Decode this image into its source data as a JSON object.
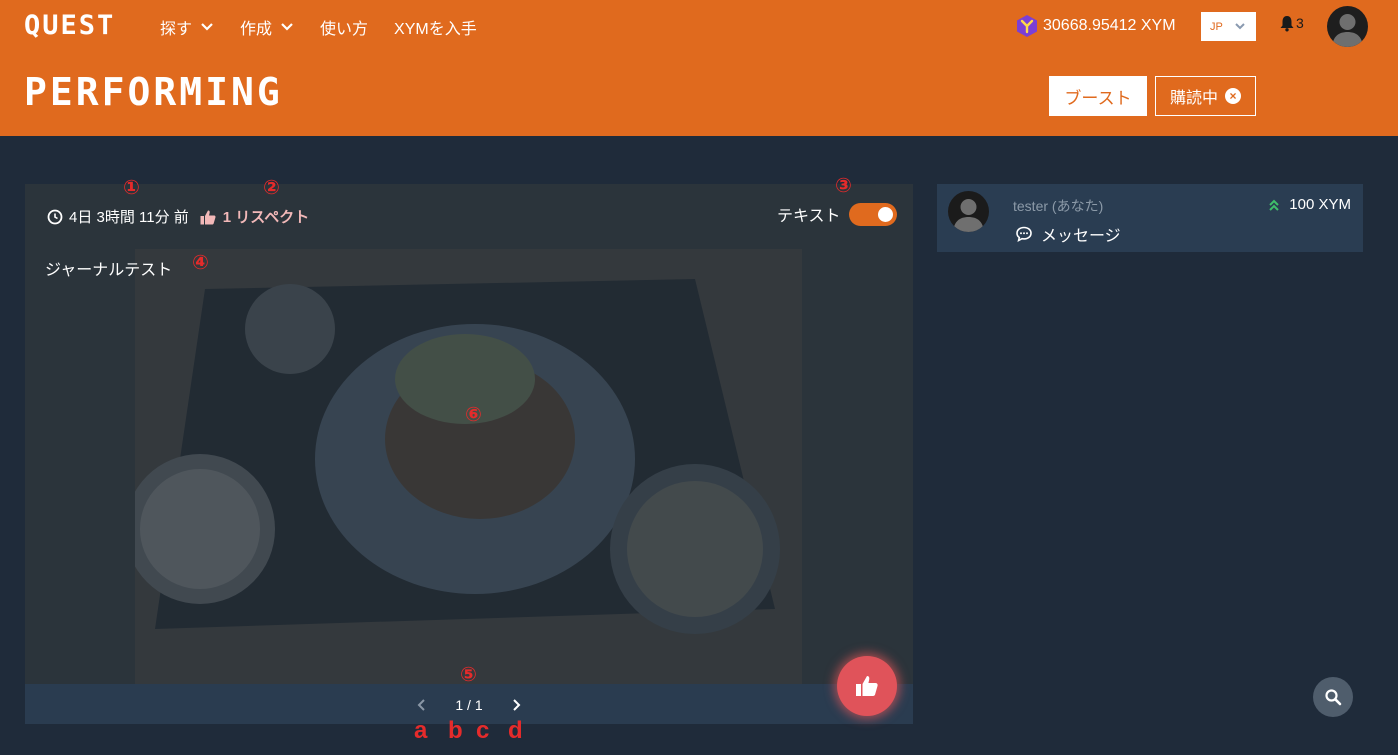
{
  "header": {
    "logo": "QUEST",
    "nav": [
      {
        "label": "探す"
      },
      {
        "label": "作成"
      },
      {
        "label": "使い方"
      },
      {
        "label": "XYMを入手"
      }
    ],
    "page_title": "PERFORMING",
    "balance": "30668.95412 XYM",
    "language": "JP",
    "notifications_count": "3",
    "boost_label": "ブースト",
    "subscribing_label": "購読中"
  },
  "journal": {
    "time_ago": "4日 3時間 11分 前",
    "respect": "1 リスペクト",
    "toggle_label": "テキスト",
    "toggle_on": true,
    "text": "ジャーナルテスト",
    "pager": "1 / 1"
  },
  "side": {
    "user": "tester (あなた)",
    "amount": "100 XYM",
    "message_label": "メッセージ"
  },
  "annotations": {
    "m1": "①",
    "m2": "②",
    "m3": "③",
    "m4": "④",
    "m5": "⑤",
    "m6": "⑥",
    "a": "a",
    "b": "b",
    "c": "c",
    "d": "d"
  },
  "colors": {
    "brand_orange": "#e06a1e",
    "page_bg": "#1f2b3a",
    "card_bg": "#283a4d",
    "like_red": "#e0535a",
    "annotation_red": "#e52b2b"
  }
}
